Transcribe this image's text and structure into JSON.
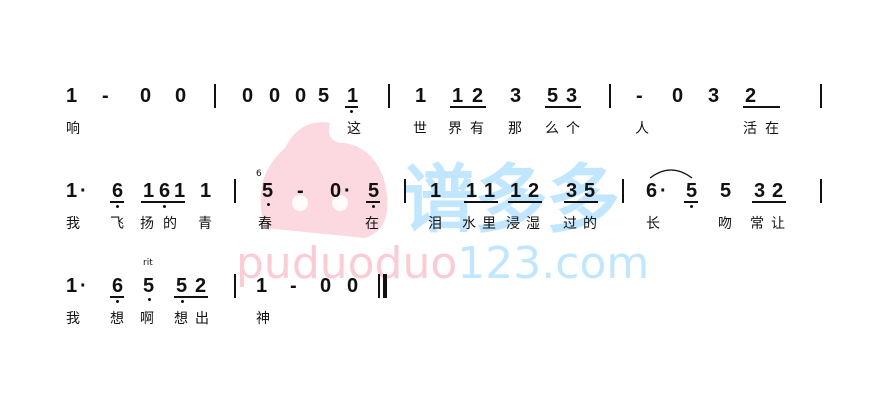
{
  "watermark": {
    "brand": "谱多多",
    "url_pink": "puduoduo",
    "url_blue": "123.com"
  },
  "line1": {
    "notes": [
      "1",
      "-",
      "0",
      "0",
      "0",
      "0",
      "0",
      "5",
      "1",
      "1",
      "1",
      "2",
      "3",
      "5",
      "3",
      "-",
      "0",
      "3",
      "2"
    ],
    "lyrics": [
      "响",
      "这",
      "世",
      "界",
      "有",
      "那",
      "么",
      "个",
      "人",
      "活",
      "在"
    ]
  },
  "line2": {
    "notes": [
      "1",
      "·",
      "6",
      "1",
      "6",
      "1",
      "5",
      "-",
      "0",
      "·",
      "5",
      "1",
      "1",
      "1",
      "1",
      "2",
      "3",
      "5",
      "6",
      "·",
      "5",
      "5",
      "3",
      "2"
    ],
    "grace": "6",
    "lyrics": [
      "我",
      "飞",
      "扬",
      "的",
      "青",
      "春",
      "在",
      "泪",
      "水",
      "里",
      "浸",
      "湿",
      "过",
      "的",
      "长",
      "吻",
      "常",
      "让"
    ]
  },
  "line3": {
    "notes": [
      "1",
      "·",
      "6",
      "5",
      "5",
      "2",
      "1",
      "-",
      "0",
      "0"
    ],
    "mark": "rit",
    "lyrics": [
      "我",
      "想",
      "啊",
      "想",
      "出",
      "神"
    ]
  }
}
